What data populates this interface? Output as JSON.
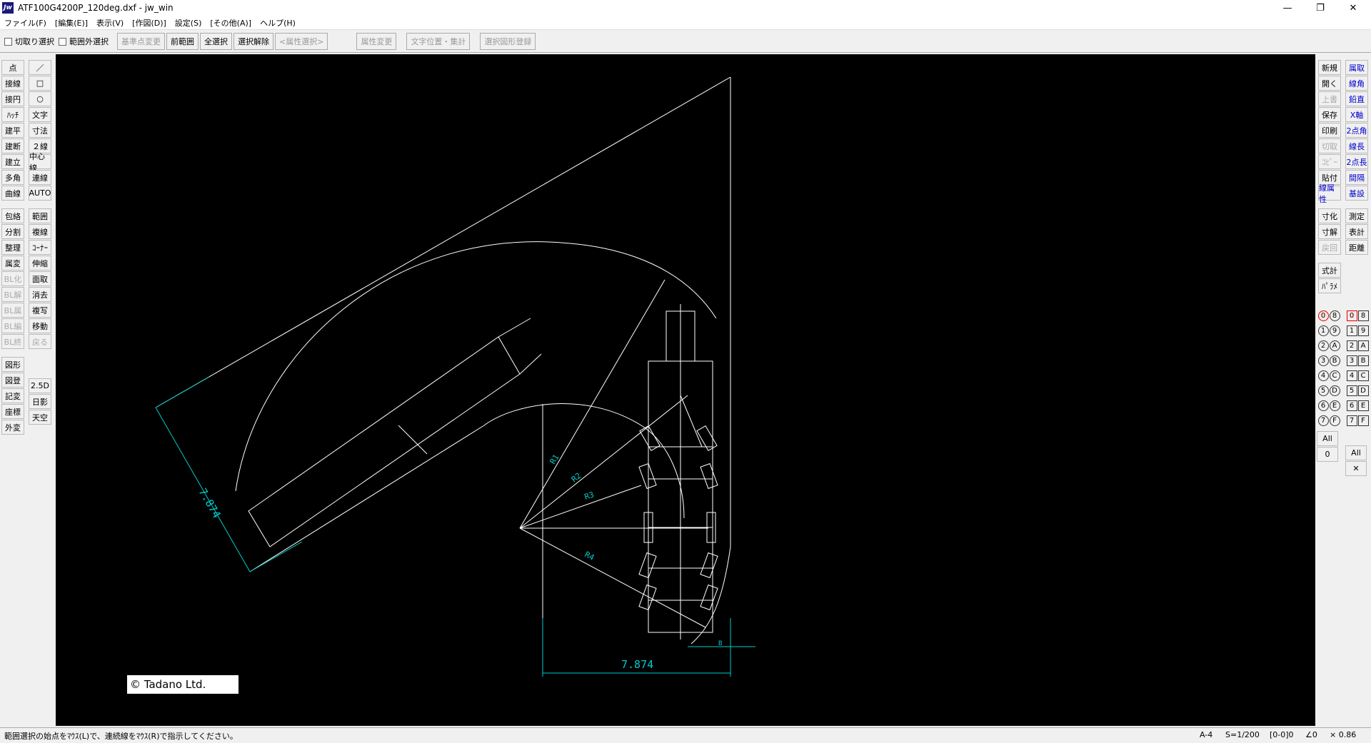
{
  "window": {
    "title": "ATF100G4200P_120deg.dxf - jw_win",
    "app_icon": "Jw",
    "controls": {
      "minimize": "—",
      "maximize": "❐",
      "close": "✕"
    }
  },
  "menu": [
    "ファイル(F)",
    "[編集(E)]",
    "表示(V)",
    "[作図(D)]",
    "設定(S)",
    "[その他(A)]",
    "ヘルプ(H)"
  ],
  "toolbar": {
    "checkboxes": [
      "切取り選択",
      "範囲外選択"
    ],
    "buttons": [
      {
        "label": "基準点変更",
        "disabled": true
      },
      {
        "label": "前範囲",
        "disabled": false
      },
      {
        "label": "全選択",
        "disabled": false
      },
      {
        "label": "選択解除",
        "disabled": false
      },
      {
        "label": "<属性選択>",
        "disabled": true
      },
      {
        "label": "属性変更",
        "disabled": true
      },
      {
        "label": "文字位置・集計",
        "disabled": true
      },
      {
        "label": "選択図形登録",
        "disabled": true
      }
    ]
  },
  "left_tools": {
    "col1": [
      "点",
      "接線",
      "接円",
      "ﾊｯﾁ",
      "建平",
      "建断",
      "建立",
      "多角",
      "曲線",
      "包絡",
      "分割",
      "整理",
      "属変",
      "BL化",
      "BL解",
      "BL属",
      "BL編",
      "BL終",
      "図形",
      "図登",
      "記変",
      "座標",
      "外変"
    ],
    "col2": [
      "／",
      "□",
      "○",
      "文字",
      "寸法",
      "２線",
      "中心線",
      "連線",
      "AUTO",
      "範囲",
      "複線",
      "ｺｰﾅｰ",
      "伸縮",
      "面取",
      "消去",
      "複写",
      "移動",
      "戻る",
      "2.5D",
      "日影",
      "天空"
    ]
  },
  "right_tools": {
    "col1": [
      "新規",
      "開く",
      "上書",
      "保存",
      "印刷",
      "切取",
      "ｺﾋﾟｰ",
      "貼付",
      "線属性",
      "寸化",
      "寸解",
      "戻回",
      "式計",
      "ﾊﾟﾗﾒ"
    ],
    "col2": [
      "属取",
      "線角",
      "鉛直",
      "X軸",
      "2点角",
      "線長",
      "2点長",
      "間隔",
      "基設",
      "測定",
      "表計",
      "距離"
    ]
  },
  "layers": {
    "groups_left": [
      "0",
      "1",
      "2",
      "3",
      "4",
      "5",
      "6",
      "7"
    ],
    "groups_right": [
      "8",
      "9",
      "A",
      "B",
      "C",
      "D",
      "E",
      "F"
    ],
    "layers_left": [
      "0",
      "1",
      "2",
      "3",
      "4",
      "5",
      "6",
      "7"
    ],
    "layers_right": [
      "8",
      "9",
      "A",
      "B",
      "C",
      "D",
      "E",
      "F"
    ],
    "all_label": "All",
    "zero_label": "0",
    "x_label": "✕"
  },
  "drawing": {
    "dim_text_1": "7.874",
    "dim_text_2": "7.874",
    "r1": "R1",
    "r2": "R2",
    "r3": "R3",
    "r4": "R4",
    "small_b": "B",
    "copyright": "© Tadano Ltd.",
    "line_color": "#ffffff",
    "dim_color": "#00cccc"
  },
  "status": {
    "message": "範囲選択の始点をﾏｳｽ(L)で、連続線をﾏｳｽ(R)で指示してください。",
    "paper": "A-4",
    "scale": "S=1/200",
    "layer": "[0-0]0",
    "angle": "∠0",
    "zoom": "× 0.86"
  }
}
